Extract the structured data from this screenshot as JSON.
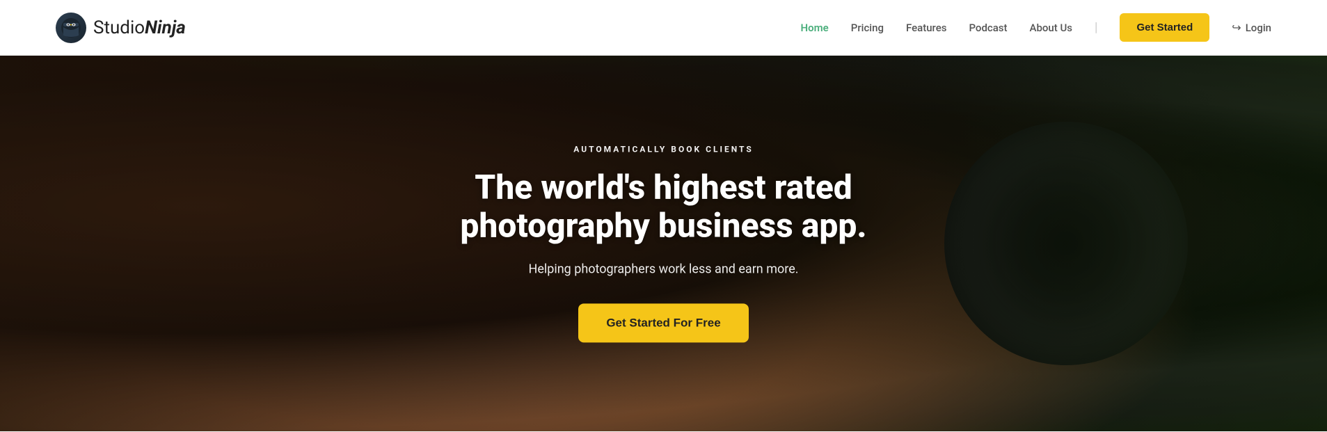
{
  "header": {
    "logo": {
      "text_studio": "Studio",
      "text_ninja": "Ninja"
    },
    "nav": {
      "items": [
        {
          "label": "Home",
          "active": true
        },
        {
          "label": "Pricing"
        },
        {
          "label": "Features"
        },
        {
          "label": "Podcast"
        },
        {
          "label": "About Us"
        }
      ]
    },
    "cta_button": "Get Started",
    "login_label": "Login"
  },
  "hero": {
    "eyebrow": "AUTOMATICALLY BOOK CLIENTS",
    "headline_line1": "The world's highest rated",
    "headline_line2": "photography business app.",
    "subheadline": "Helping photographers work less and earn more.",
    "cta_button": "Get Started For Free"
  },
  "colors": {
    "accent_yellow": "#f5c518",
    "nav_active": "#4caf7d",
    "text_dark": "#222222"
  }
}
